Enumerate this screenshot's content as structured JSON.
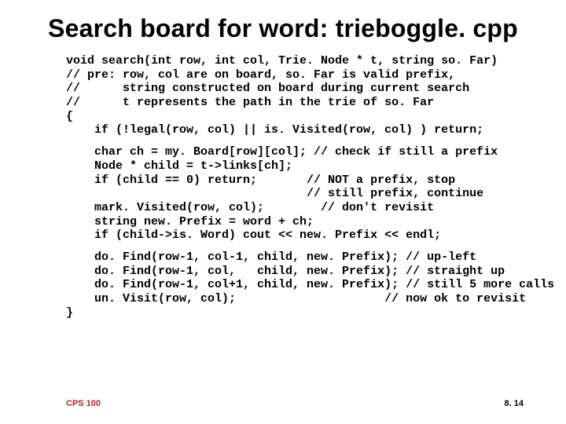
{
  "title": "Search board for word: trieboggle. cpp",
  "code": {
    "l01": "void search(int row, int col, Trie. Node * t, string so. Far)",
    "l02": "// pre: row, col are on board, so. Far is valid prefix,",
    "l03": "//      string constructed on board during current search",
    "l04": "//      t represents the path in the trie of so. Far",
    "l05": "{",
    "l06": "    if (!legal(row, col) || is. Visited(row, col) ) return;",
    "l07": "    char ch = my. Board[row][col]; // check if still a prefix",
    "l08": "    Node * child = t->links[ch];",
    "l09": "    if (child == 0) return;       // NOT a prefix, stop",
    "l10": "                                  // still prefix, continue",
    "l11": "    mark. Visited(row, col);        // don't revisit",
    "l12": "    string new. Prefix = word + ch;",
    "l13": "    if (child->is. Word) cout << new. Prefix << endl;",
    "l14": "    do. Find(row-1, col-1, child, new. Prefix); // up-left",
    "l15": "    do. Find(row-1, col,   child, new. Prefix); // straight up",
    "l16": "    do. Find(row-1, col+1, child, new. Prefix); // still 5 more calls",
    "l17": "    un. Visit(row, col);                     // now ok to revisit",
    "l18": "}"
  },
  "footer": {
    "left": "CPS 100",
    "right": "8. 14"
  }
}
